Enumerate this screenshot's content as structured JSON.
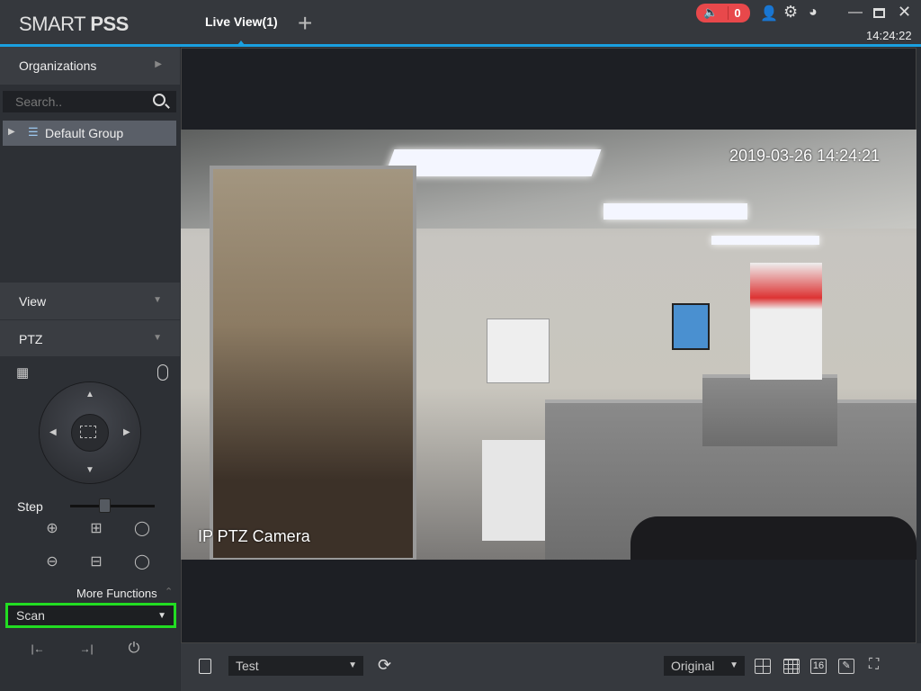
{
  "header": {
    "logo_light": "SMART ",
    "logo_bold": "PSS",
    "tab": "Live View(1)",
    "add_tab": "+",
    "alarm_count": "0",
    "clock": "14:24:22"
  },
  "sidebar": {
    "organizations": "Organizations",
    "search_placeholder": "Search..",
    "group": "Default Group",
    "view": "View",
    "ptz": "PTZ",
    "step": "Step",
    "more_functions": "More Functions",
    "function_select": "Scan"
  },
  "video": {
    "timestamp": "2019-03-26 14:24:21",
    "camera_name": "IP PTZ Camera"
  },
  "bottom": {
    "view_select": "Test",
    "stream_select": "Original",
    "layout_16": "16"
  },
  "colors": {
    "accent": "#1aa0e0",
    "alarm": "#e8484b",
    "highlight": "#22dd22"
  }
}
